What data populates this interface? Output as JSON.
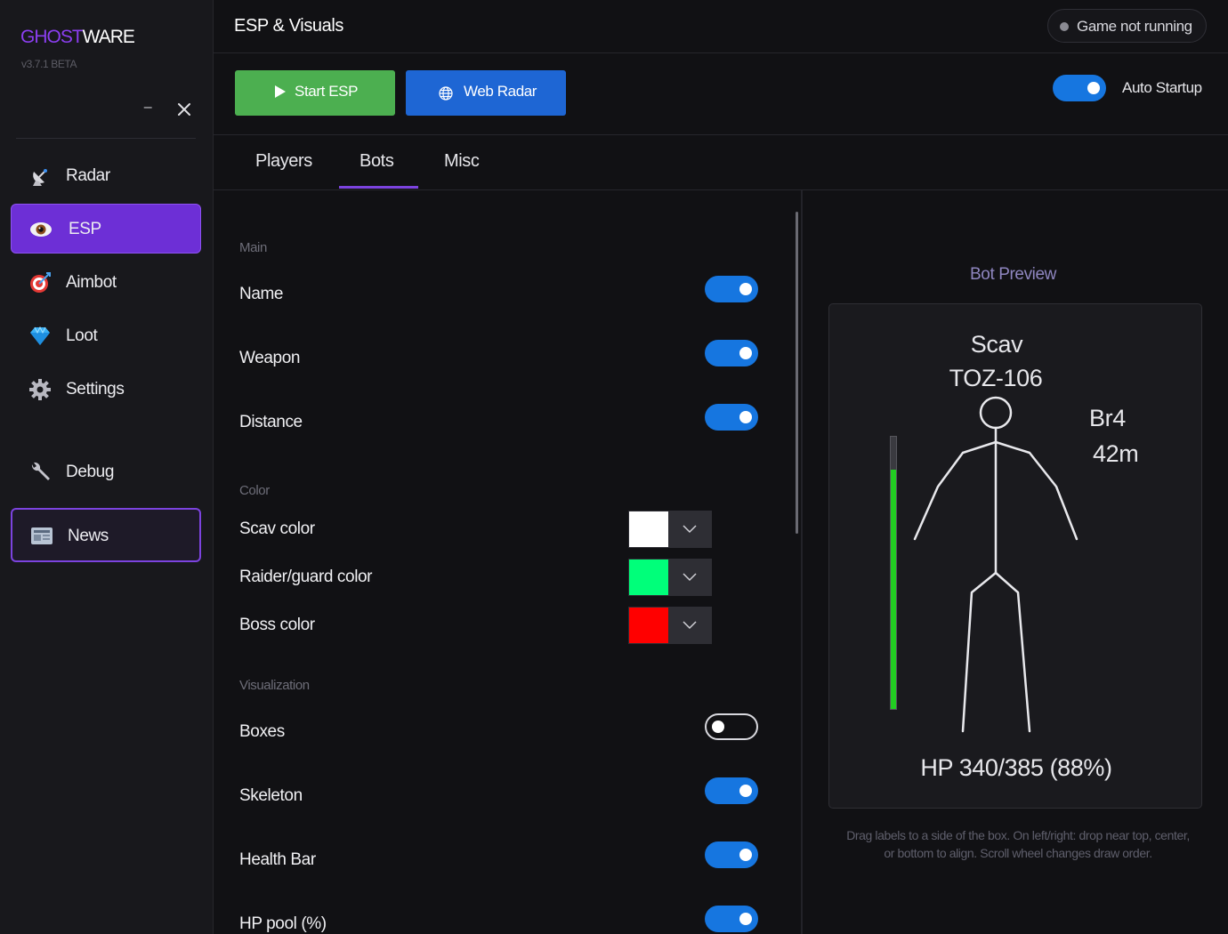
{
  "app": {
    "brand_primary": "GHOST",
    "brand_secondary": "WARE",
    "version": "v3.7.1 BETA",
    "minimize_symbol": "–"
  },
  "sidebar": {
    "items": [
      {
        "label": "Radar",
        "icon": "satellite-dish-icon"
      },
      {
        "label": "ESP",
        "icon": "eye-icon",
        "active": true
      },
      {
        "label": "Aimbot",
        "icon": "target-icon"
      },
      {
        "label": "Loot",
        "icon": "diamond-icon"
      },
      {
        "label": "Settings",
        "icon": "gear-icon"
      },
      {
        "label": "Debug",
        "icon": "wrench-icon"
      },
      {
        "label": "News",
        "icon": "newspaper-icon"
      }
    ]
  },
  "header": {
    "title": "ESP & Visuals",
    "status": "Game not running"
  },
  "toolbar": {
    "start_label": "Start ESP",
    "radar_label": "Web Radar",
    "auto_startup_label": "Auto Startup",
    "auto_startup_on": true
  },
  "tabs": [
    {
      "label": "Players"
    },
    {
      "label": "Bots",
      "active": true
    },
    {
      "label": "Misc"
    }
  ],
  "settings": {
    "main_header": "Main",
    "name_label": "Name",
    "name_on": true,
    "weapon_label": "Weapon",
    "weapon_on": true,
    "distance_label": "Distance",
    "distance_on": true,
    "color_header": "Color",
    "scav_color_label": "Scav color",
    "scav_color": "#ffffff",
    "raider_color_label": "Raider/guard color",
    "raider_color": "#00ff7a",
    "boss_color_label": "Boss color",
    "boss_color": "#ff0000",
    "vis_header": "Visualization",
    "boxes_label": "Boxes",
    "boxes_on": false,
    "skeleton_label": "Skeleton",
    "skeleton_on": true,
    "health_label": "Health Bar",
    "health_on": true,
    "hppool_label": "HP pool (%)",
    "hppool_on": true
  },
  "preview": {
    "title": "Bot Preview",
    "name": "Scav",
    "weapon": "TOZ-106",
    "armor": "Br4",
    "distance": "42m",
    "hp": "HP 340/385 (88%)",
    "health_fraction": 0.88,
    "hint": "Drag labels to a side of the box. On left/right: drop near top, center, or bottom to align. Scroll wheel changes draw order."
  }
}
